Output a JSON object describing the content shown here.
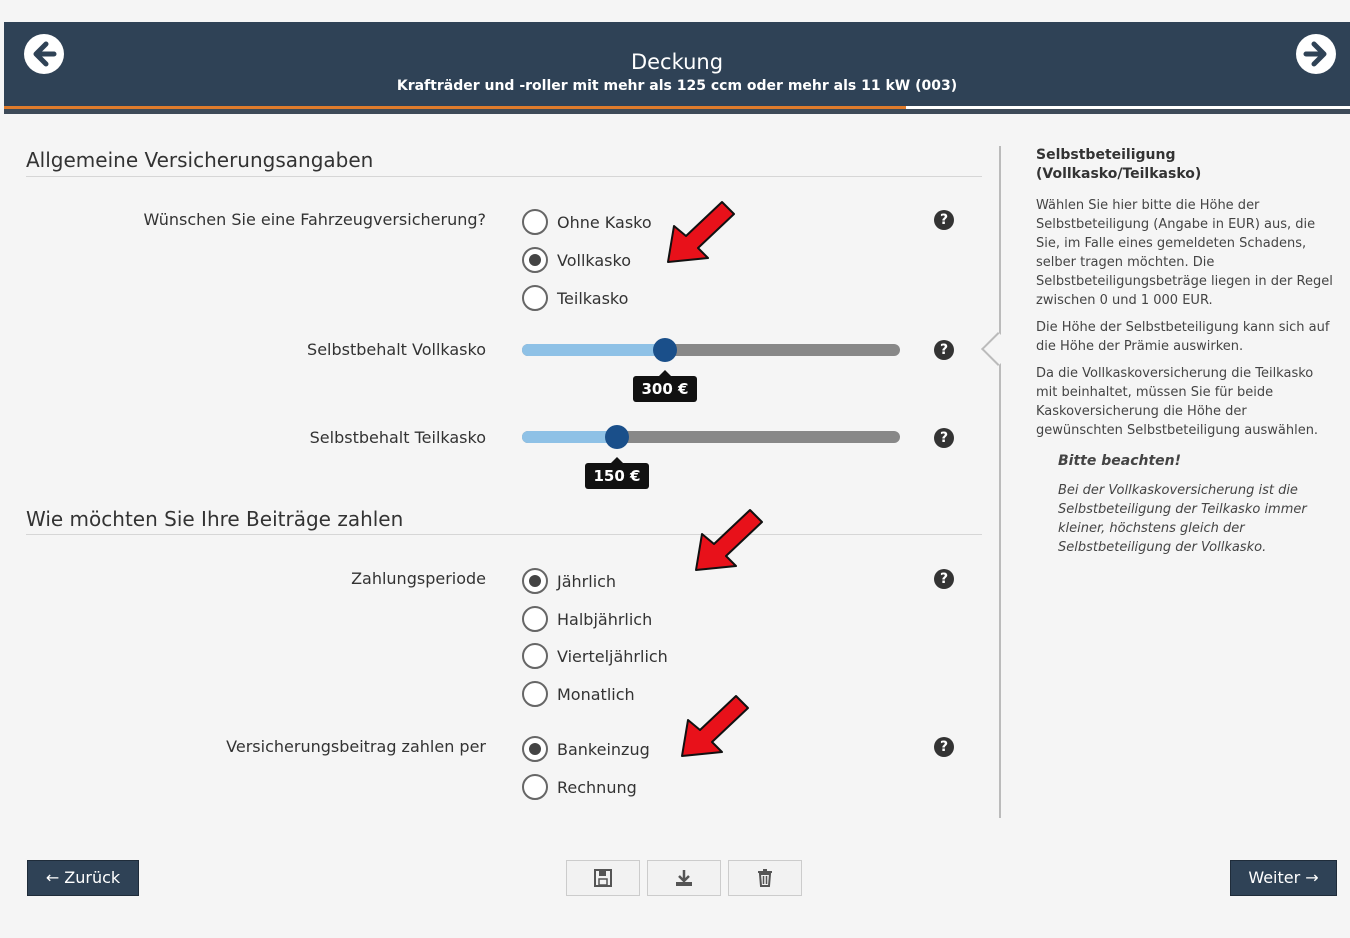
{
  "header": {
    "title": "Deckung",
    "subtitle": "Krafträder und -roller mit mehr als 125 ccm oder mehr als 11 kW (003)",
    "progress_percent": 67
  },
  "section1": {
    "title": "Allgemeine Versicherungsangaben",
    "q_insurance": {
      "label": "Wünschen Sie eine Fahrzeugversicherung?",
      "options": [
        "Ohne Kasko",
        "Vollkasko",
        "Teilkasko"
      ],
      "selected": "Vollkasko"
    },
    "slider_vollkasko": {
      "label": "Selbstbehalt Vollkasko",
      "value_label": "300 €",
      "fraction": 0.377
    },
    "slider_teilkasko": {
      "label": "Selbstbehalt Teilkasko",
      "value_label": "150 €",
      "fraction": 0.25
    }
  },
  "section2": {
    "title": "Wie möchten Sie Ihre Beiträge zahlen",
    "q_period": {
      "label": "Zahlungsperiode",
      "options": [
        "Jährlich",
        "Halbjährlich",
        "Vierteljährlich",
        "Monatlich"
      ],
      "selected": "Jährlich"
    },
    "q_method": {
      "label": "Versicherungsbeitrag zahlen per",
      "options": [
        "Bankeinzug",
        "Rechnung"
      ],
      "selected": "Bankeinzug"
    }
  },
  "sidebar": {
    "heading": "Selbstbeteiligung (Vollkasko/Teilkasko)",
    "p1": "Wählen Sie hier bitte die Höhe der Selbstbeteiligung (Angabe in EUR) aus, die Sie, im Falle eines gemeldeten Schadens, selber tragen möchten. Die Selbstbeteiligungsbeträge liegen in der Regel zwischen 0 und 1 000 EUR.",
    "p2": "Die Höhe der Selbstbeteiligung kann sich auf die Höhe der Prämie auswirken.",
    "p3": "Da die Vollkaskoversicherung die Teilkasko mit beinhaltet, müssen Sie für beide Kaskoversicherung die Höhe der gewünschten Selbstbeteiligung auswählen.",
    "note_title": "Bitte beachten!",
    "note": "Bei der Vollkaskoversicherung ist die Selbstbeteiligung der Teilkasko immer kleiner, höchstens gleich der Selbstbeteiligung der Vollkasko."
  },
  "footer": {
    "back_label": "← Zurück",
    "next_label": "Weiter →"
  },
  "help_icon": "?",
  "colors": {
    "header_bg": "#2f4256",
    "progress": "#e07b2b",
    "slider_fill": "#8ec1e6",
    "slider_thumb": "#1a4f8a",
    "annotation_arrow": "#e8111a"
  }
}
